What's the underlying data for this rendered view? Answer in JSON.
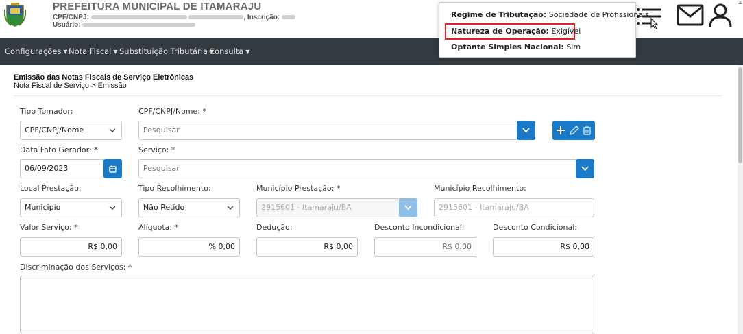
{
  "header": {
    "org_title": "PREFEITURA MUNICIPAL DE ITAMARAJU",
    "cpf_label": "CPF/CNPJ:",
    "inscricao_label": ", Inscrição:",
    "usuario_label": "Usuário:"
  },
  "popover": {
    "regime_label": "Regime de Tributação:",
    "regime_value": "Sociedade de Profissionais",
    "natureza_label": "Natureza de Operação:",
    "natureza_value": "Exigível",
    "optante_label": "Optante Simples Nacional:",
    "optante_value": "Sim"
  },
  "nav": {
    "items": [
      "Configurações",
      "Nota Fiscal",
      "Substituição Tributária",
      "Consulta"
    ]
  },
  "breadcrumb": {
    "title": "Emissão das Notas Fiscais de Serviço Eletrônicas",
    "path": "Nota Fiscal de Serviço > Emissão"
  },
  "form": {
    "tipo_tomador": {
      "label": "Tipo Tomador:",
      "value": "CPF/CNPJ/Nome"
    },
    "cpf_cnpj_nome": {
      "label": "CPF/CNPJ/Nome: *",
      "placeholder": "Pesquisar"
    },
    "data_fato_gerador": {
      "label": "Data Fato Gerador: *",
      "value": "06/09/2023"
    },
    "servico": {
      "label": "Serviço: *",
      "placeholder": "Pesquisar"
    },
    "local_prestacao": {
      "label": "Local Prestação:",
      "value": "Município"
    },
    "tipo_recolhimento": {
      "label": "Tipo Recolhimento:",
      "value": "Não Retido"
    },
    "municipio_prestacao": {
      "label": "Município Prestação: *",
      "value": "2915601 - Itamaraju/BA"
    },
    "municipio_recolhimento": {
      "label": "Município Recolhimento:",
      "value": "2915601 - Itamaraju/BA"
    },
    "valor_servico": {
      "label": "Valor Serviço: *",
      "value": "R$ 0,00"
    },
    "aliquota": {
      "label": "Alíquota: *",
      "value": "% 0,00"
    },
    "deducao": {
      "label": "Dedução:",
      "value": "R$ 0,00"
    },
    "desconto_incondicional": {
      "label": "Desconto Incondicional:",
      "value": "R$ 0,00"
    },
    "desconto_condicional": {
      "label": "Desconto Condicional:",
      "value": "R$ 0,00"
    },
    "discriminacao": {
      "label": "Discriminação dos Serviços: *"
    }
  },
  "colors": {
    "navbar": "#333a40",
    "primary": "#1a7ac8",
    "highlight": "#e51c23"
  }
}
